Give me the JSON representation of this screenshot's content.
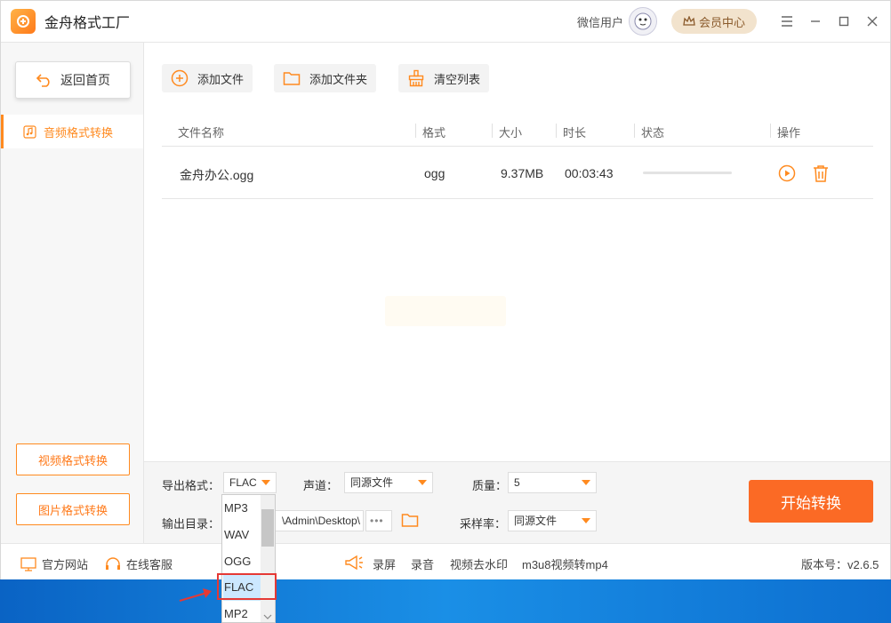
{
  "app": {
    "title": "金舟格式工厂",
    "version_label": "版本号：v2.6.5"
  },
  "header": {
    "user_name": "微信用户",
    "vip_label": "会员中心"
  },
  "sidebar": {
    "home_label": "返回首页",
    "active_item": "音频格式转换",
    "video_button": "视频格式转换",
    "image_button": "图片格式转换"
  },
  "toolbar": {
    "add_file": "添加文件",
    "add_folder": "添加文件夹",
    "clear_list": "清空列表"
  },
  "table": {
    "columns": {
      "name": "文件名称",
      "format": "格式",
      "size": "大小",
      "duration": "时长",
      "status": "状态",
      "actions": "操作"
    },
    "rows": [
      {
        "name": "金舟办公.ogg",
        "format": "ogg",
        "size": "9.37MB",
        "duration": "00:03:43"
      }
    ]
  },
  "settings": {
    "export_format_label": "导出格式：",
    "export_format_value": "FLAC",
    "channel_label": "声道：",
    "channel_value": "同源文件",
    "quality_label": "质量：",
    "quality_value": "5",
    "output_dir_label": "输出目录：",
    "output_dir_value": "\\Admin\\Desktop\\",
    "more_label": "•••",
    "sample_rate_label": "采样率：",
    "sample_rate_value": "同源文件",
    "start_button": "开始转换"
  },
  "dropdown": {
    "options": [
      "MP3",
      "WAV",
      "OGG",
      "FLAC",
      "MP2"
    ],
    "selected": "FLAC"
  },
  "footer": {
    "website": "官方网站",
    "support": "在线客服",
    "record_screen": "录屏",
    "record_audio": "录音",
    "watermark": "视频去水印",
    "m3u8": "m3u8视频转mp4"
  },
  "colors": {
    "accent": "#ff8a1f",
    "start_button": "#fb6a25",
    "selection": "#cce8ff",
    "highlight_box": "#e53935"
  }
}
